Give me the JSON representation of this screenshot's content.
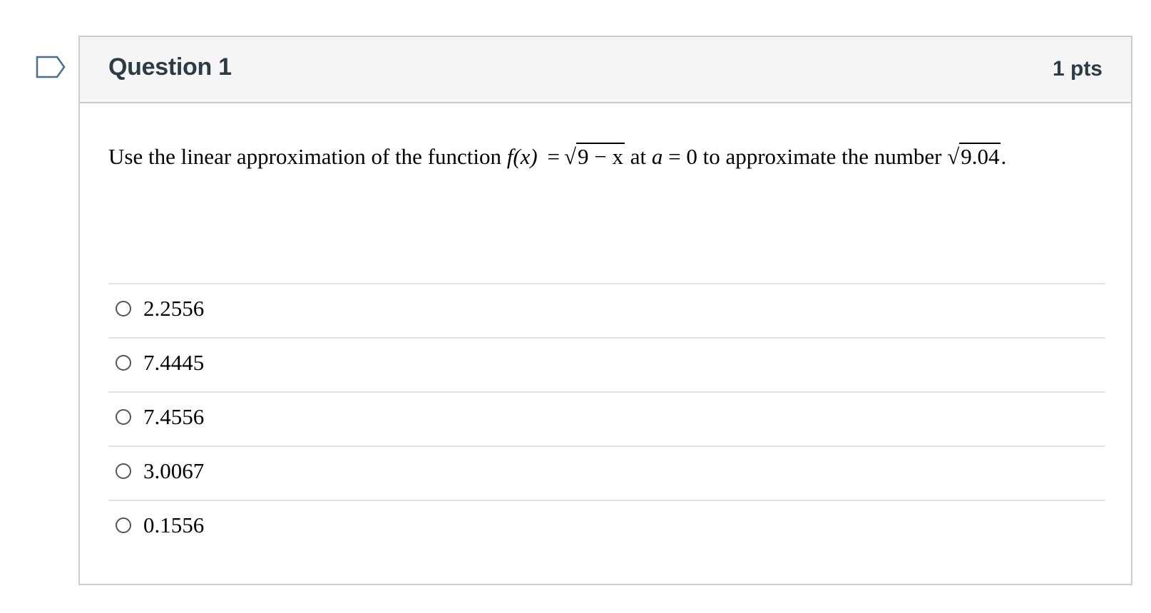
{
  "flag": {
    "icon": "bookmark-flag-icon",
    "color": "#4a6d8c"
  },
  "question": {
    "title": "Question 1",
    "points": "1 pts",
    "text": {
      "intro": "Use the linear approximation of the function",
      "func_name": "f",
      "func_arg": "(x)",
      "equals": "=",
      "radicand": "9 − x",
      "mid": "at",
      "a_var": "a",
      "a_eq": "= 0",
      "outro": "to approximate the number",
      "number_radicand": "9.04",
      "end": "."
    },
    "answers": [
      {
        "label": "2.2556",
        "selected": false
      },
      {
        "label": "7.4445",
        "selected": false
      },
      {
        "label": "7.4556",
        "selected": false
      },
      {
        "label": "3.0067",
        "selected": false
      },
      {
        "label": "0.1556",
        "selected": false
      }
    ]
  },
  "colors": {
    "header_bg": "#f5f5f5",
    "border": "#c7cdd1",
    "title_text": "#2d3b45",
    "divider": "#dfe3e5"
  }
}
